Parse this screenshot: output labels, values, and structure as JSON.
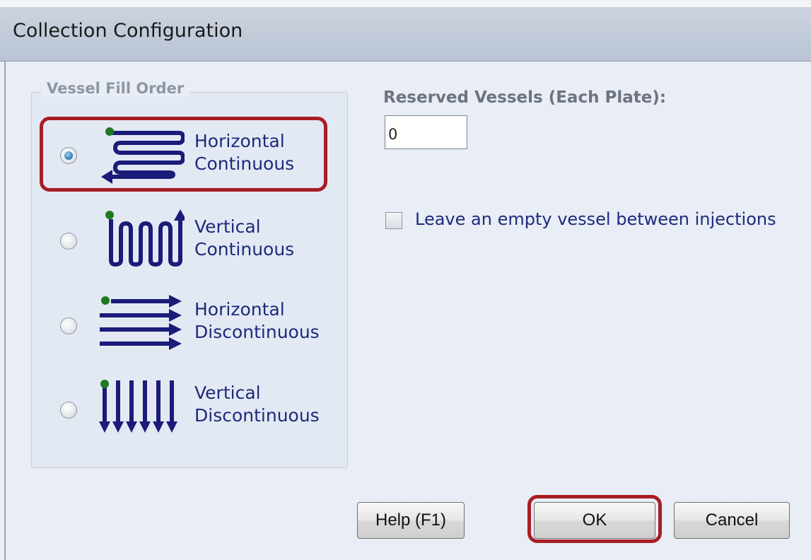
{
  "window": {
    "title": "Collection Configuration"
  },
  "fill_order": {
    "legend": "Vessel Fill Order",
    "selected": "Horizontal Continuous",
    "options": [
      {
        "label": "Horizontal\nContinuous",
        "icon": "horizontal-continuous-icon",
        "checked": true
      },
      {
        "label": "Vertical\nContinuous",
        "icon": "vertical-continuous-icon",
        "checked": false
      },
      {
        "label": "Horizontal\nDiscontinuous",
        "icon": "horizontal-discontinuous-icon",
        "checked": false
      },
      {
        "label": "Vertical\nDiscontinuous",
        "icon": "vertical-discontinuous-icon",
        "checked": false
      }
    ]
  },
  "reserved": {
    "label": "Reserved Vessels (Each Plate):",
    "value": "0"
  },
  "empty_vessel": {
    "label": "Leave an empty vessel between injections",
    "checked": false
  },
  "buttons": {
    "help": "Help (F1)",
    "ok": "OK",
    "cancel": "Cancel"
  },
  "colors": {
    "icon": "#1b1b7a",
    "start_dot": "#1f7a1f",
    "highlight": "#a71e24",
    "label_text": "#1e2a7c"
  }
}
